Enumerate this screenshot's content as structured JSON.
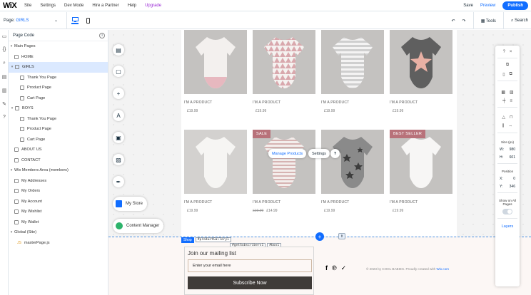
{
  "topbar": {
    "logo": "WiX",
    "menu": [
      "Site",
      "Settings",
      "Dev Mode",
      "Hire a Partner",
      "Help"
    ],
    "upgrade": "Upgrade",
    "save": "Save",
    "preview": "Preview",
    "publish": "Publish"
  },
  "secondbar": {
    "page_label": "Page:",
    "page_value": "GIRLS",
    "tools": "Tools",
    "search": "Search"
  },
  "panel": {
    "title": "Page Code",
    "main_pages": "Main Pages",
    "pages": [
      "HOME",
      "GIRLS",
      "Thank You Page",
      "Product Page",
      "Cart Page",
      "BOYS",
      "Thank You Page",
      "Product Page",
      "Cart Page",
      "ABOUT US",
      "CONTACT"
    ],
    "members_title": "Wix Members Area (members)",
    "members": [
      "My Addresses",
      "My Orders",
      "My Account",
      "My Wishlist",
      "My Wallet"
    ],
    "global_title": "Global (Site)",
    "global_file": "masterPage.js"
  },
  "products": [
    {
      "name": "I'M A PRODUCT",
      "price": "£19.99",
      "old_price": "",
      "ribbon": ""
    },
    {
      "name": "I'M A PRODUCT",
      "price": "£19.99",
      "old_price": "",
      "ribbon": ""
    },
    {
      "name": "I'M A PRODUCT",
      "price": "£19.99",
      "old_price": "",
      "ribbon": ""
    },
    {
      "name": "I'M A PRODUCT",
      "price": "£19.99",
      "old_price": "",
      "ribbon": ""
    },
    {
      "name": "I'M A PRODUCT",
      "price": "£19.99",
      "old_price": "",
      "ribbon": ""
    },
    {
      "name": "I'M A PRODUCT",
      "price": "£14.99",
      "old_price": "£19.99",
      "ribbon": "SALE"
    },
    {
      "name": "I'M A PRODUCT",
      "price": "£19.99",
      "old_price": "",
      "ribbon": ""
    },
    {
      "name": "I'M A PRODUCT",
      "price": "£19.99",
      "old_price": "",
      "ribbon": "BEST SELLER"
    }
  ],
  "canvas": {
    "manage_products": "Manage Products",
    "settings": "Settings",
    "help": "?",
    "my_store": "My Store",
    "content_manager": "Content Manager",
    "shop_tag": "Shop",
    "id_tags": [
      "#productGallery1",
      "#getSubscribers1",
      "#box1"
    ]
  },
  "footer": {
    "mailing_title": "Join our mailing list",
    "email_placeholder": "Enter your email here",
    "subscribe": "Subscribe Now",
    "copyright": "© 2023 by COOL BABIES. Proudly created with",
    "wix_link": "Wix.com"
  },
  "right_panel": {
    "size_label": "Size (px)",
    "w_label": "W:",
    "w": "980",
    "h_label": "H:",
    "h": "601",
    "position_label": "Position",
    "x_label": "X:",
    "x": "0",
    "y_label": "Y:",
    "y": "346",
    "show_all": "Show on All Pages",
    "layers": "Layers"
  },
  "colors": {
    "accent": "#116dff",
    "upgrade": "#9a27d5",
    "ribbon": "#b8727a",
    "footer_bg": "#fcf7f5",
    "subscribe_btn": "#3f3b38"
  }
}
